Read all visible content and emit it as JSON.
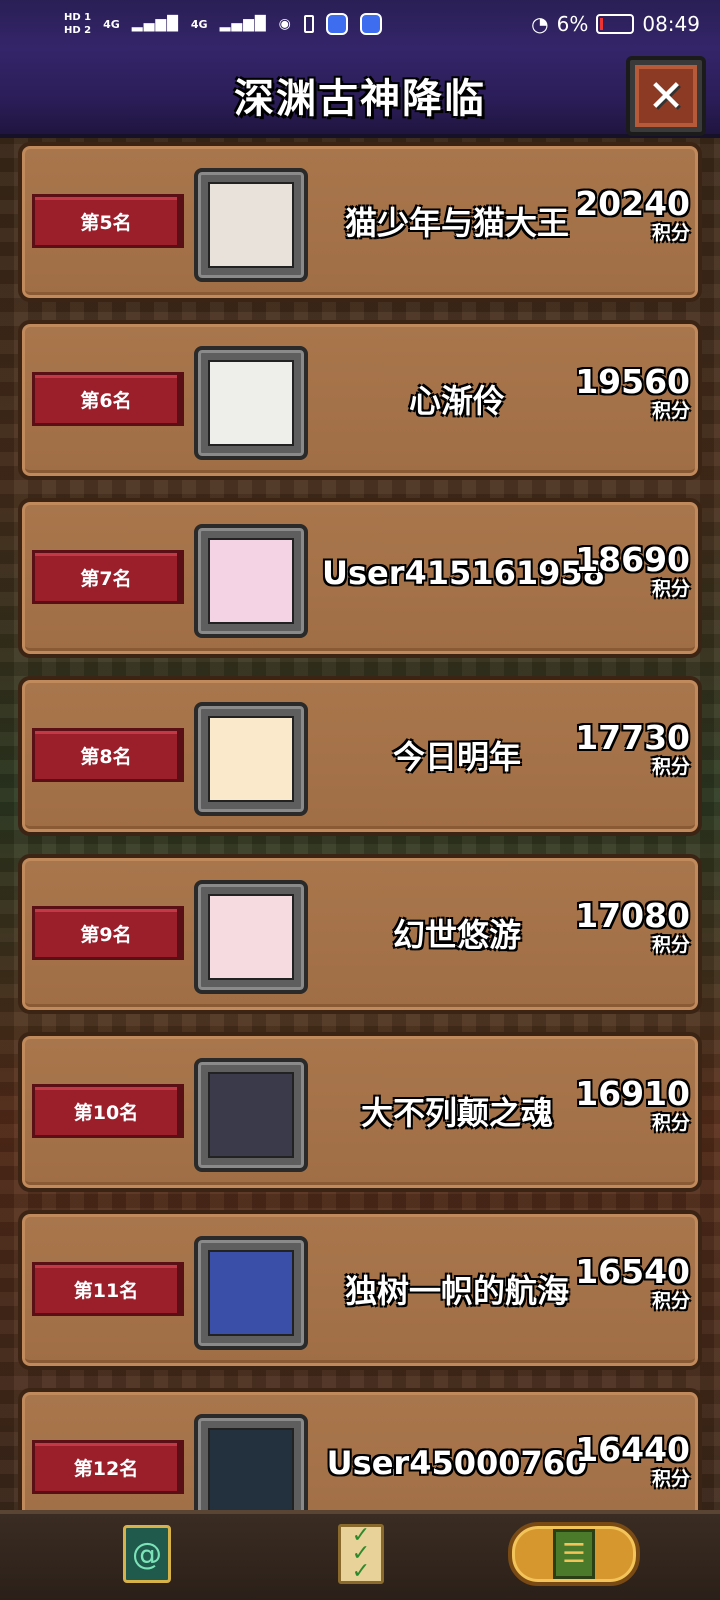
{
  "status_bar": {
    "hd1": "HD 1",
    "hd2": "HD 2",
    "signal1": "4G",
    "signal2": "4G",
    "battery_percent": "6%",
    "time": "08:49"
  },
  "header": {
    "title": "深渊古神降临"
  },
  "score_label": "积分",
  "players": [
    {
      "rank": "第5名",
      "name": "猫少年与猫大王",
      "score": "20240",
      "avatar_color": "#e9e2da"
    },
    {
      "rank": "第6名",
      "name": "心渐伶",
      "score": "19560",
      "avatar_color": "#eeeeea"
    },
    {
      "rank": "第7名",
      "name": "User415161958",
      "score": "18690",
      "avatar_color": "#f3d3e4"
    },
    {
      "rank": "第8名",
      "name": "今日明年",
      "score": "17730",
      "avatar_color": "#fbe9cc"
    },
    {
      "rank": "第9名",
      "name": "幻世悠游",
      "score": "17080",
      "avatar_color": "#f6dce0"
    },
    {
      "rank": "第10名",
      "name": "大不列颠之魂",
      "score": "16910",
      "avatar_color": "#3a3a4a"
    },
    {
      "rank": "第11名",
      "name": "独树一帜的航海",
      "score": "16540",
      "avatar_color": "#3a4fa8"
    },
    {
      "rank": "第12名",
      "name": "User45000760",
      "score": "16440",
      "avatar_color": "#23313f"
    }
  ],
  "bottom_nav": {
    "items": [
      "card-icon",
      "quest-scroll-icon",
      "leaderboard-icon"
    ]
  }
}
